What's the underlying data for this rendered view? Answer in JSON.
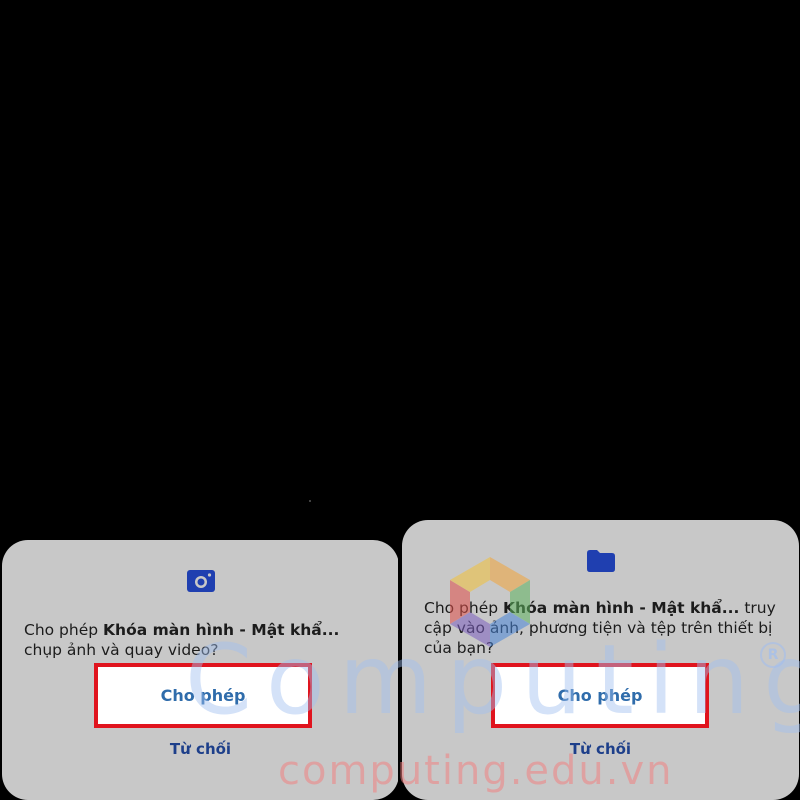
{
  "dialogs": {
    "left": {
      "icon": "camera-icon",
      "message_prefix": "Cho phép ",
      "app_name": "Khóa màn hình - Mật khẩ...",
      "message_suffix": " chụp ảnh và quay video?",
      "allow_label": "Cho phép",
      "deny_label": "Từ chối"
    },
    "right": {
      "icon": "folder-icon",
      "message_prefix": "Cho phép ",
      "app_name": "Khóa màn hình - Mật khẩ...",
      "message_suffix": " truy cập vào ảnh, phương tiện và tệp trên thiết bị của bạn?",
      "allow_label": "Cho phép",
      "deny_label": "Từ chối"
    }
  },
  "watermark": {
    "brand": "Computing",
    "registered": "R",
    "url": "computing.edu.vn"
  },
  "colors": {
    "background": "#000000",
    "dialog": "#c8c8c8",
    "highlight_border": "#e0141e",
    "allow_text": "#2f6cab",
    "deny_text": "#1d3f8a",
    "icon_blue": "#1f3fb0"
  }
}
